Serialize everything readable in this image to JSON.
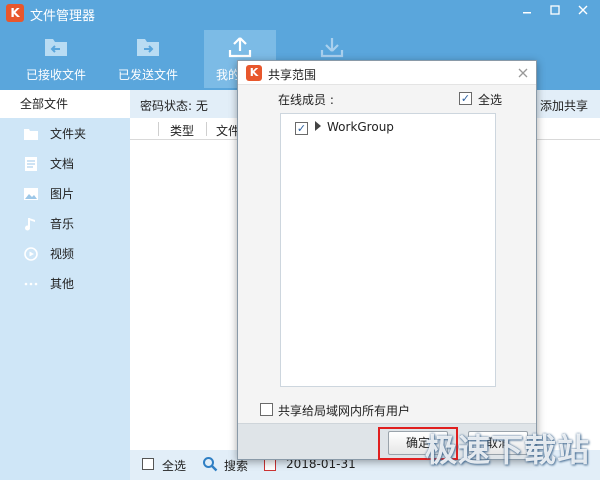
{
  "app": {
    "title": "文件管理器",
    "logo_text": "K",
    "window_controls": [
      "minimize-icon",
      "maximize-icon",
      "close-icon"
    ]
  },
  "toolbar": {
    "items": [
      {
        "label": "已接收文件",
        "icon": "received-files-icon"
      },
      {
        "label": "已发送文件",
        "icon": "sent-files-icon"
      },
      {
        "label": "我的",
        "icon": "upload-icon",
        "active": true
      },
      {
        "label": "",
        "icon": "download-icon"
      }
    ]
  },
  "sidebar": {
    "all_files": "全部文件",
    "items": [
      {
        "label": "文件夹",
        "icon": "folder-icon"
      },
      {
        "label": "文档",
        "icon": "document-icon"
      },
      {
        "label": "图片",
        "icon": "image-icon"
      },
      {
        "label": "音乐",
        "icon": "music-icon"
      },
      {
        "label": "视频",
        "icon": "video-icon"
      },
      {
        "label": "其他",
        "icon": "more-icon"
      }
    ]
  },
  "main": {
    "password_status": "密码状态: 无",
    "add_share": "添加共享",
    "columns": {
      "type": "类型",
      "file": "文件"
    },
    "bottom": {
      "select_all": "全选",
      "search": "搜索",
      "date": "2018-01-31"
    }
  },
  "dialog": {
    "title": "共享范围",
    "logo_text": "K",
    "online_members_label": "在线成员 :",
    "select_all_label": "全选",
    "select_all_checked": true,
    "members": [
      {
        "name": "WorkGroup",
        "checked": true
      }
    ],
    "share_all_label": "共享给局域网内所有用户",
    "share_all_checked": false,
    "ok_label": "确定",
    "cancel_label": "取消"
  },
  "colors": {
    "titlebar": "#5aa6dc",
    "sidebar": "#cfe6f7",
    "highlight": "#e01f1f",
    "logo": "#e8572c"
  },
  "watermark": "极速下载站"
}
